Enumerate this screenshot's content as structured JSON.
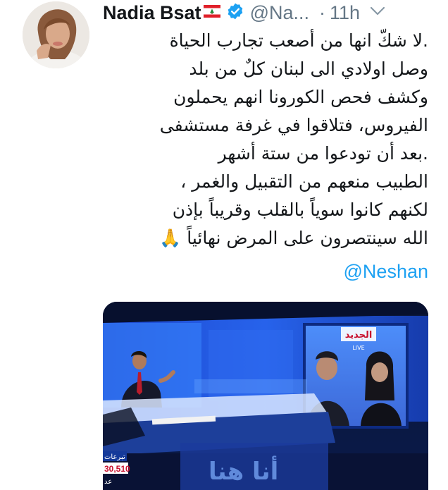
{
  "tweet": {
    "author_name": "Nadia Bsat",
    "author_handle": "@Na...",
    "separator": "·",
    "time": "11h",
    "text_lines": [
      ".لا شكّ انها من أصعب تجارب الحياة",
      "وصل اولادي الى لبنان كلٌ من بلد",
      "وكشف فحص الكورونا انهم يحملون",
      "الفيروس، فتلاقوا في غرفة مستشفى",
      ".بعد أن تودعوا من ستة أشهر",
      "الطبيب منعهم من التقبيل والغمر ،",
      "لكنهم كانوا سوياً بالقلب وقريباً بإذن",
      "الله سينتصرون على المرض نهائياً 🙏"
    ],
    "mention": "@Neshan"
  },
  "media": {
    "channel_logo": "الجديد",
    "live_label": "LIVE",
    "ticker_label": "تبرعات",
    "ticker_value": "30,510",
    "ticker_suffix": "عد",
    "show_title": "أنا هنا"
  },
  "icons": {
    "flag": "lebanon-flag-icon",
    "verified": "verified-badge-icon",
    "menu": "chevron-down-icon"
  },
  "colors": {
    "link": "#1da1f2",
    "muted": "#657786",
    "text": "#14171a",
    "verified": "#1da1f2"
  }
}
